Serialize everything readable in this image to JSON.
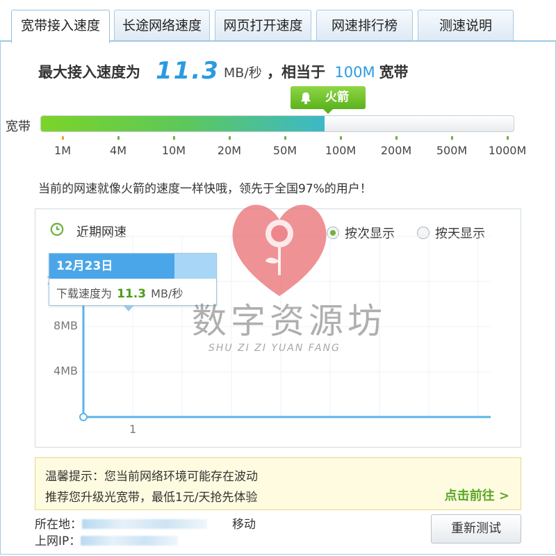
{
  "tabs": [
    {
      "label": "宽带接入速度",
      "active": true
    },
    {
      "label": "长途网络速度",
      "active": false
    },
    {
      "label": "网页打开速度",
      "active": false
    },
    {
      "label": "网速排行榜",
      "active": false
    },
    {
      "label": "测速说明",
      "active": false
    }
  ],
  "headline": {
    "prefix": "最大接入速度为",
    "speed": "11.3",
    "unit": "MB/秒",
    "middle": "，相当于",
    "bandwidth": "100M",
    "suffix": "宽带"
  },
  "gauge": {
    "label": "宽带",
    "badge_text": "火箭",
    "badge_icon": "bell-icon",
    "fill_fraction": 0.6,
    "ticks": [
      "1M",
      "4M",
      "10M",
      "20M",
      "50M",
      "100M",
      "200M",
      "500M",
      "1000M"
    ],
    "colors": {
      "fill_start": "#7bd428",
      "fill_end": "#3cb8c8",
      "badge": "#6cc12c"
    }
  },
  "comparison_text": "当前的网速就像火箭的速度一样快哦，领先于全国97%的用户！",
  "recent": {
    "title": "近期网速",
    "icon": "clock-icon",
    "options": [
      {
        "label": "按次显示",
        "selected": true
      },
      {
        "label": "按天显示",
        "selected": false
      }
    ],
    "tooltip": {
      "date": "12月23日",
      "prefix": "下载速度为",
      "value": "11.3",
      "unit": "MB/秒"
    }
  },
  "chart_data": {
    "type": "line",
    "title": "",
    "x": [
      1
    ],
    "series": [
      {
        "values": [
          11.3
        ]
      }
    ],
    "xticks": [
      "1"
    ],
    "yticks": [
      "4MB",
      "8MB",
      "12MB"
    ],
    "ylim": [
      0,
      16
    ],
    "grid": true,
    "xlabel": "",
    "ylabel": ""
  },
  "notice": {
    "line1": "温馨提示：您当前网络环境可能存在波动",
    "line2": "推荐您升级光宽带，最低1元/天抢先体验",
    "link": "点击前往 >"
  },
  "footer": {
    "location_label": "所在地：",
    "carrier": "移动",
    "ip_label": "上网IP：",
    "retest_button": "重新测试"
  },
  "watermark": {
    "title": "数字资源坊",
    "subtitle": "SHU ZI ZI YUAN FANG"
  }
}
